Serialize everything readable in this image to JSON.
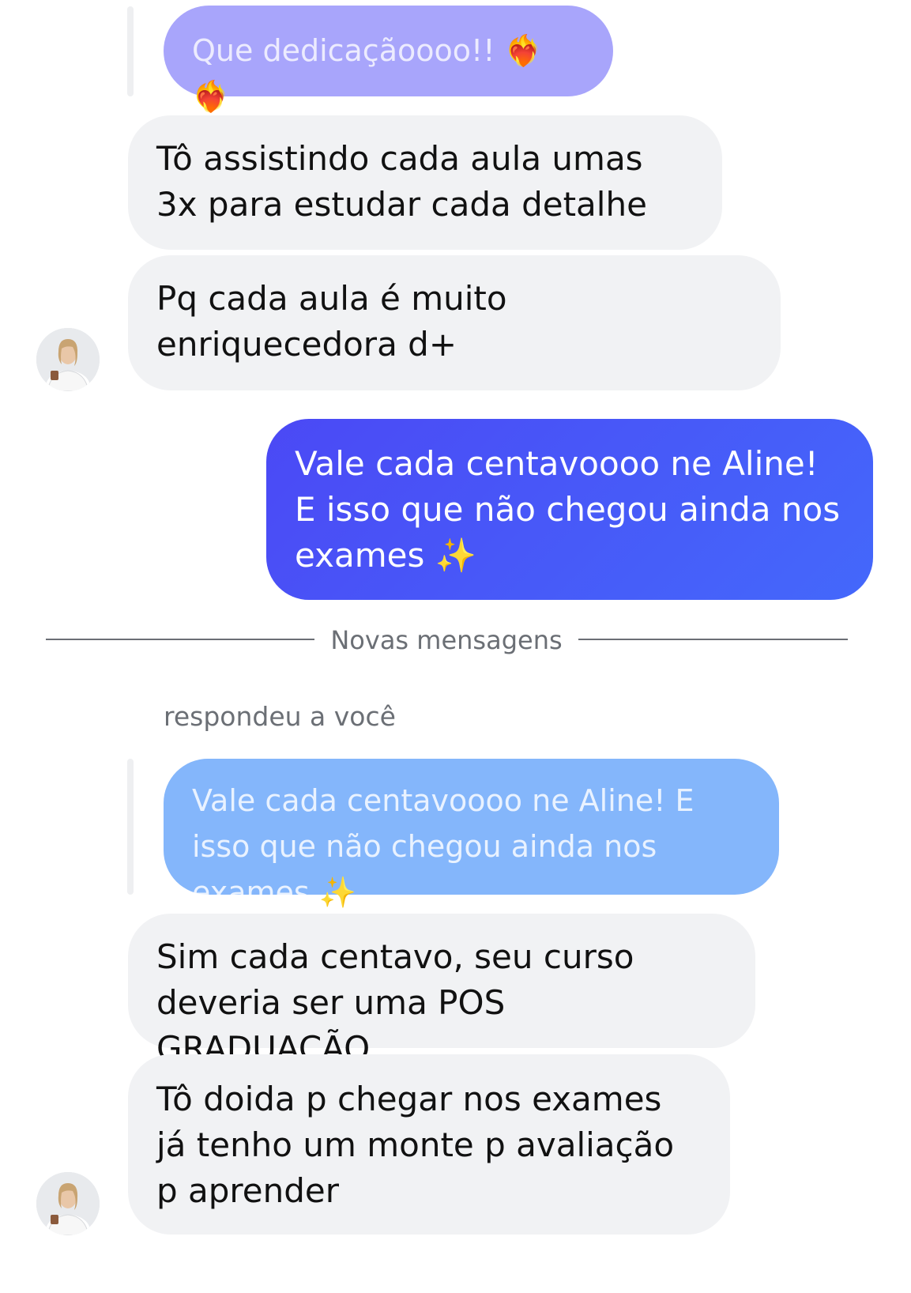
{
  "thread": {
    "quoted_top": {
      "text": "Que dedicaçãoooo!!",
      "emoji": "❤️‍🔥 ❤️‍🔥"
    },
    "incoming_1": "Tô assistindo cada aula umas 3x para estudar cada detalhe",
    "incoming_2": "Pq cada aula é muito enriquecedora d+",
    "outgoing_1": {
      "text": "Vale cada centavoooo ne Aline! E isso que não chegou ainda nos exames",
      "emoji": "✨"
    },
    "divider_label": "Novas mensagens",
    "reply_note": "respondeu a você",
    "quoted_reply": {
      "text": "Vale cada centavoooo ne Aline! E isso que não chegou ainda nos exames",
      "emoji": "✨"
    },
    "incoming_3": "Sim cada centavo, seu curso deveria ser uma POS GRADUAÇÃO",
    "incoming_4": "Tô doida p chegar nos exames já tenho um monte p avaliação p aprender"
  },
  "colors": {
    "incoming_bg": "#f1f2f4",
    "outgoing_bg": "#4b55f8",
    "quote_purple": "#a8a5fb",
    "quote_blue": "#84b6fb",
    "muted_text": "#6b6f75"
  },
  "icons": {
    "avatar": "user-avatar-photo",
    "heart_on_fire": "heart-on-fire-emoji",
    "sparkles": "sparkles-emoji"
  }
}
